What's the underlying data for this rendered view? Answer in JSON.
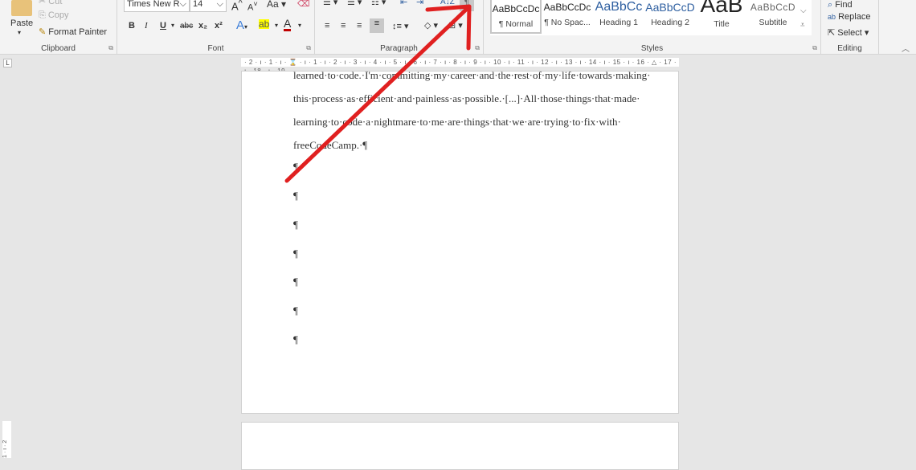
{
  "clipboard": {
    "paste": "Paste",
    "cut": "Cut",
    "copy": "Copy",
    "format_painter": "Format Painter",
    "label": "Clipboard"
  },
  "font": {
    "name": "Times New R",
    "size": "14",
    "case": "Aa",
    "bold": "B",
    "italic": "I",
    "underline": "U",
    "strike": "abc",
    "subscript": "x₂",
    "superscript": "x²",
    "label": "Font"
  },
  "paragraph": {
    "label": "Paragraph",
    "show_marks": "¶",
    "sort": "A↓Z"
  },
  "styles": {
    "label": "Styles",
    "items": [
      {
        "preview": "AaBbCcDc",
        "name": "¶ Normal"
      },
      {
        "preview": "AaBbCcDc",
        "name": "¶ No Spac..."
      },
      {
        "preview": "AaBbCc",
        "name": "Heading 1"
      },
      {
        "preview": "AaBbCcD",
        "name": "Heading 2"
      },
      {
        "preview": "AaB",
        "name": "Title"
      },
      {
        "preview": "AaBbCcD",
        "name": "Subtitle"
      }
    ]
  },
  "editing": {
    "find": "Find",
    "replace": "Replace",
    "select": "Select",
    "label": "Editing"
  },
  "ruler": {
    "text": "· 2 · ı · 1 · ı · ⌛ · ı · 1 · ı · 2 · ı · 3 · ı · 4 · ı · 5 · ı · 6 · ı · 7 · ı · 8 · ı · 9 · ı · 10 · ı · 11 · ı · 12 · ı · 13 · ı · 14 · ı · 15 · ı · 16 · △ · 17 · ı · 18 · ı · 19",
    "vertical": "1 · ı · 2"
  },
  "document": {
    "lines": [
      "learned·to·code.·I'm·committing·my·career·and·the·rest·of·my·life·towards·making·",
      "this·process·as·efficient·and·painless·as·possible.·[...]·All·those·things·that·made·",
      "learning·to·code·a·nightmare·to·me·are·things·that·we·are·trying·to·fix·with·",
      "freeCodeCamp.·¶"
    ],
    "empty_paragraphs": [
      "¶",
      "¶",
      "¶",
      "¶",
      "¶",
      "¶",
      "¶"
    ]
  },
  "colors": {
    "annotation_arrow": "#e02020",
    "highlight": "#ffff00",
    "font_color": "#c00000"
  }
}
